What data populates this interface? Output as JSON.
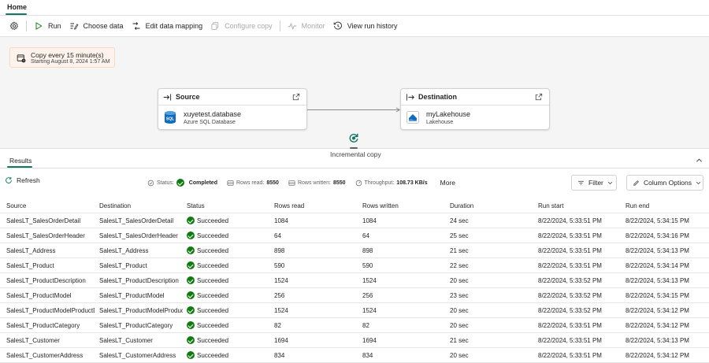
{
  "tabs": {
    "home": "Home"
  },
  "toolbar": {
    "run": "Run",
    "choose_data": "Choose data",
    "edit_mapping": "Edit data mapping",
    "configure_copy": "Configure copy",
    "monitor": "Monitor",
    "view_history": "View run history"
  },
  "schedule": {
    "line1": "Copy every 15 minute(s)",
    "line2": "Starting August 8, 2024 1:57 AM"
  },
  "source": {
    "title": "Source",
    "name": "xuyetest.database",
    "sub": "Azure SQL Database"
  },
  "destination": {
    "title": "Destination",
    "name": "myLakehouse",
    "sub": "Lakehouse"
  },
  "connector": {
    "label": "Incremental copy"
  },
  "results": {
    "tab": "Results",
    "refresh": "Refresh",
    "status_label": "Status:",
    "status_value": "Completed",
    "rows_read_label": "Rows read:",
    "rows_read_value": "8550",
    "rows_written_label": "Rows written:",
    "rows_written_value": "8550",
    "throughput_label": "Throughput:",
    "throughput_value": "108.73 KB/s",
    "more": "More",
    "filter": "Filter",
    "column_options": "Column Options"
  },
  "table": {
    "headers": [
      "Source",
      "Destination",
      "Status",
      "Rows read",
      "Rows written",
      "Duration",
      "Run start",
      "Run end"
    ],
    "rows": [
      [
        "SalesLT_SalesOrderDetail",
        "SalesLT_SalesOrderDetail",
        "Succeeded",
        "1084",
        "1084",
        "24 sec",
        "8/22/2024, 5:33:51 PM",
        "8/22/2024, 5:34:15 PM"
      ],
      [
        "SalesLT_SalesOrderHeader",
        "SalesLT_SalesOrderHeader",
        "Succeeded",
        "64",
        "64",
        "25 sec",
        "8/22/2024, 5:33:51 PM",
        "8/22/2024, 5:34:16 PM"
      ],
      [
        "SalesLT_Address",
        "SalesLT_Address",
        "Succeeded",
        "898",
        "898",
        "21 sec",
        "8/22/2024, 5:33:51 PM",
        "8/22/2024, 5:34:13 PM"
      ],
      [
        "SalesLT_Product",
        "SalesLT_Product",
        "Succeeded",
        "590",
        "590",
        "22 sec",
        "8/22/2024, 5:33:51 PM",
        "8/22/2024, 5:34:14 PM"
      ],
      [
        "SalesLT_ProductDescription",
        "SalesLT_ProductDescription",
        "Succeeded",
        "1524",
        "1524",
        "20 sec",
        "8/22/2024, 5:33:52 PM",
        "8/22/2024, 5:34:13 PM"
      ],
      [
        "SalesLT_ProductModel",
        "SalesLT_ProductModel",
        "Succeeded",
        "256",
        "256",
        "23 sec",
        "8/22/2024, 5:33:52 PM",
        "8/22/2024, 5:34:15 PM"
      ],
      [
        "SalesLT_ProductModelProductDe",
        "SalesLT_ProductModelProductI",
        "Succeeded",
        "1524",
        "1524",
        "20 sec",
        "8/22/2024, 5:33:52 PM",
        "8/22/2024, 5:34:12 PM"
      ],
      [
        "SalesLT_ProductCategory",
        "SalesLT_ProductCategory",
        "Succeeded",
        "82",
        "82",
        "20 sec",
        "8/22/2024, 5:33:51 PM",
        "8/22/2024, 5:34:12 PM"
      ],
      [
        "SalesLT_Customer",
        "SalesLT_Customer",
        "Succeeded",
        "1694",
        "1694",
        "21 sec",
        "8/22/2024, 5:33:51 PM",
        "8/22/2024, 5:34:13 PM"
      ],
      [
        "SalesLT_CustomerAddress",
        "SalesLT_CustomerAddress",
        "Succeeded",
        "834",
        "834",
        "20 sec",
        "8/22/2024, 5:33:51 PM",
        "8/22/2024, 5:34:12 PM"
      ]
    ]
  }
}
